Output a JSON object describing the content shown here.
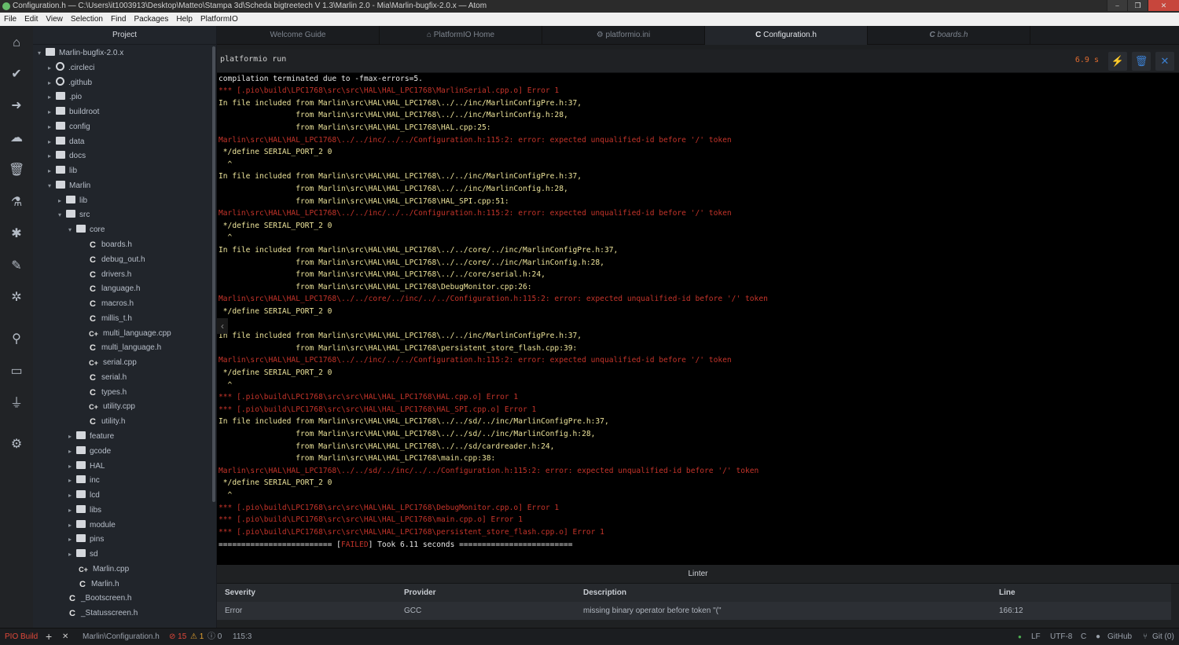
{
  "window": {
    "title": "Configuration.h — C:\\Users\\it1003913\\Desktop\\Matteo\\Stampa 3d\\Scheda bigtreetech V 1.3\\Marlin 2.0 - Mia\\Marlin-bugfix-2.0.x — Atom",
    "controls": [
      "⎯",
      "❐",
      "✕"
    ]
  },
  "menu": [
    "File",
    "Edit",
    "View",
    "Selection",
    "Find",
    "Packages",
    "Help",
    "PlatformIO"
  ],
  "leftbar_icons": [
    "home-icon",
    "check-icon",
    "arrow-right-icon",
    "cloud-upload-icon",
    "trash-icon",
    "flask-icon",
    "bug-icon",
    "edit-doc-icon",
    "device-icon",
    "search-icon",
    "terminal-icon",
    "plug-icon",
    "gear-icon"
  ],
  "tree": {
    "title": "Project",
    "rows": [
      {
        "label": "Marlin-bugfix-2.0.x",
        "indent": 0,
        "type": "folder",
        "open": true
      },
      {
        "label": ".circleci",
        "indent": 1,
        "type": "folder-special",
        "open": false
      },
      {
        "label": ".github",
        "indent": 1,
        "type": "folder-github",
        "open": false
      },
      {
        "label": ".pio",
        "indent": 1,
        "type": "folder",
        "open": false
      },
      {
        "label": "buildroot",
        "indent": 1,
        "type": "folder",
        "open": false
      },
      {
        "label": "config",
        "indent": 1,
        "type": "folder",
        "open": false
      },
      {
        "label": "data",
        "indent": 1,
        "type": "folder",
        "open": false
      },
      {
        "label": "docs",
        "indent": 1,
        "type": "folder",
        "open": false
      },
      {
        "label": "lib",
        "indent": 1,
        "type": "folder",
        "open": false
      },
      {
        "label": "Marlin",
        "indent": 1,
        "type": "folder",
        "open": true
      },
      {
        "label": "lib",
        "indent": 2,
        "type": "folder",
        "open": false
      },
      {
        "label": "src",
        "indent": 2,
        "type": "folder",
        "open": true
      },
      {
        "label": "core",
        "indent": 3,
        "type": "folder",
        "open": true
      },
      {
        "label": "boards.h",
        "indent": 4,
        "type": "file-c"
      },
      {
        "label": "debug_out.h",
        "indent": 4,
        "type": "file-c"
      },
      {
        "label": "drivers.h",
        "indent": 4,
        "type": "file-c"
      },
      {
        "label": "language.h",
        "indent": 4,
        "type": "file-c"
      },
      {
        "label": "macros.h",
        "indent": 4,
        "type": "file-c"
      },
      {
        "label": "millis_t.h",
        "indent": 4,
        "type": "file-c"
      },
      {
        "label": "multi_language.cpp",
        "indent": 4,
        "type": "file-cpp"
      },
      {
        "label": "multi_language.h",
        "indent": 4,
        "type": "file-c"
      },
      {
        "label": "serial.cpp",
        "indent": 4,
        "type": "file-cpp"
      },
      {
        "label": "serial.h",
        "indent": 4,
        "type": "file-c"
      },
      {
        "label": "types.h",
        "indent": 4,
        "type": "file-c"
      },
      {
        "label": "utility.cpp",
        "indent": 4,
        "type": "file-cpp"
      },
      {
        "label": "utility.h",
        "indent": 4,
        "type": "file-c"
      },
      {
        "label": "feature",
        "indent": 3,
        "type": "folder",
        "open": false
      },
      {
        "label": "gcode",
        "indent": 3,
        "type": "folder",
        "open": false
      },
      {
        "label": "HAL",
        "indent": 3,
        "type": "folder",
        "open": false
      },
      {
        "label": "inc",
        "indent": 3,
        "type": "folder",
        "open": false
      },
      {
        "label": "lcd",
        "indent": 3,
        "type": "folder",
        "open": false
      },
      {
        "label": "libs",
        "indent": 3,
        "type": "folder",
        "open": false
      },
      {
        "label": "module",
        "indent": 3,
        "type": "folder",
        "open": false
      },
      {
        "label": "pins",
        "indent": 3,
        "type": "folder",
        "open": false
      },
      {
        "label": "sd",
        "indent": 3,
        "type": "folder",
        "open": false
      },
      {
        "label": "Marlin.cpp",
        "indent": 3,
        "type": "file-cpp"
      },
      {
        "label": "Marlin.h",
        "indent": 3,
        "type": "file-c"
      },
      {
        "label": "_Bootscreen.h",
        "indent": 2,
        "type": "file-c"
      },
      {
        "label": "_Statusscreen.h",
        "indent": 2,
        "type": "file-c"
      }
    ]
  },
  "tabs": [
    {
      "label": "Welcome Guide",
      "icon": "",
      "active": false
    },
    {
      "label": "PlatformIO Home",
      "icon": "⌂",
      "active": false
    },
    {
      "label": "platformio.ini",
      "icon": "⚙",
      "active": false
    },
    {
      "label": "Configuration.h",
      "icon": "C",
      "active": true
    },
    {
      "label": "boards.h",
      "icon": "C",
      "active": false
    }
  ],
  "terminal": {
    "title": "platformio run",
    "elapsed": "6.9 s",
    "buttons": {
      "run": "⚡",
      "clear": "🗑",
      "close": "✕"
    },
    "lines": [
      {
        "t": "compilation terminated due to -fmax-errors=5.",
        "c": "w"
      },
      {
        "t": "*** [.pio\\build\\LPC1768\\src\\src\\HAL\\HAL_LPC1768\\MarlinSerial.cpp.o] Error 1",
        "c": "r"
      },
      {
        "t": "In file included from Marlin\\src\\HAL\\HAL_LPC1768\\../../inc/MarlinConfigPre.h:37,",
        "c": "y"
      },
      {
        "t": "                 from Marlin\\src\\HAL\\HAL_LPC1768\\../../inc/MarlinConfig.h:28,",
        "c": "y"
      },
      {
        "t": "                 from Marlin\\src\\HAL\\HAL_LPC1768\\HAL.cpp:25:",
        "c": "y"
      },
      {
        "t": "Marlin\\src\\HAL\\HAL_LPC1768\\../../inc/../../Configuration.h:115:2: error: expected unqualified-id before '/' token",
        "c": "r"
      },
      {
        "t": " */define SERIAL_PORT_2 0",
        "c": "y"
      },
      {
        "t": "  ^",
        "c": "y"
      },
      {
        "t": "In file included from Marlin\\src\\HAL\\HAL_LPC1768\\../../inc/MarlinConfigPre.h:37,",
        "c": "y"
      },
      {
        "t": "                 from Marlin\\src\\HAL\\HAL_LPC1768\\../../inc/MarlinConfig.h:28,",
        "c": "y"
      },
      {
        "t": "                 from Marlin\\src\\HAL\\HAL_LPC1768\\HAL_SPI.cpp:51:",
        "c": "y"
      },
      {
        "t": "Marlin\\src\\HAL\\HAL_LPC1768\\../../inc/../../Configuration.h:115:2: error: expected unqualified-id before '/' token",
        "c": "r"
      },
      {
        "t": " */define SERIAL_PORT_2 0",
        "c": "y"
      },
      {
        "t": "  ^",
        "c": "y"
      },
      {
        "t": "In file included from Marlin\\src\\HAL\\HAL_LPC1768\\../../core/../inc/MarlinConfigPre.h:37,",
        "c": "y"
      },
      {
        "t": "                 from Marlin\\src\\HAL\\HAL_LPC1768\\../../core/../inc/MarlinConfig.h:28,",
        "c": "y"
      },
      {
        "t": "                 from Marlin\\src\\HAL\\HAL_LPC1768\\../../core/serial.h:24,",
        "c": "y"
      },
      {
        "t": "                 from Marlin\\src\\HAL\\HAL_LPC1768\\DebugMonitor.cpp:26:",
        "c": "y"
      },
      {
        "t": "Marlin\\src\\HAL\\HAL_LPC1768\\../../core/../inc/../../Configuration.h:115:2: error: expected unqualified-id before '/' token",
        "c": "r"
      },
      {
        "t": " */define SERIAL_PORT_2 0",
        "c": "y"
      },
      {
        "t": "",
        "c": "y"
      },
      {
        "t": "In file included from Marlin\\src\\HAL\\HAL_LPC1768\\../../inc/MarlinConfigPre.h:37,",
        "c": "y"
      },
      {
        "t": "                 from Marlin\\src\\HAL\\HAL_LPC1768\\persistent_store_flash.cpp:39:",
        "c": "y"
      },
      {
        "t": "Marlin\\src\\HAL\\HAL_LPC1768\\../../inc/../../Configuration.h:115:2: error: expected unqualified-id before '/' token",
        "c": "r"
      },
      {
        "t": " */define SERIAL_PORT_2 0",
        "c": "y"
      },
      {
        "t": "  ^",
        "c": "y"
      },
      {
        "t": "*** [.pio\\build\\LPC1768\\src\\src\\HAL\\HAL_LPC1768\\HAL.cpp.o] Error 1",
        "c": "r"
      },
      {
        "t": "*** [.pio\\build\\LPC1768\\src\\src\\HAL\\HAL_LPC1768\\HAL_SPI.cpp.o] Error 1",
        "c": "r"
      },
      {
        "t": "In file included from Marlin\\src\\HAL\\HAL_LPC1768\\../../sd/../inc/MarlinConfigPre.h:37,",
        "c": "y"
      },
      {
        "t": "                 from Marlin\\src\\HAL\\HAL_LPC1768\\../../sd/../inc/MarlinConfig.h:28,",
        "c": "y"
      },
      {
        "t": "                 from Marlin\\src\\HAL\\HAL_LPC1768\\../../sd/cardreader.h:24,",
        "c": "y"
      },
      {
        "t": "                 from Marlin\\src\\HAL\\HAL_LPC1768\\main.cpp:38:",
        "c": "y"
      },
      {
        "t": "Marlin\\src\\HAL\\HAL_LPC1768\\../../sd/../inc/../../Configuration.h:115:2: error: expected unqualified-id before '/' token",
        "c": "r"
      },
      {
        "t": " */define SERIAL_PORT_2 0",
        "c": "y"
      },
      {
        "t": "  ^",
        "c": "y"
      },
      {
        "t": "*** [.pio\\build\\LPC1768\\src\\src\\HAL\\HAL_LPC1768\\DebugMonitor.cpp.o] Error 1",
        "c": "r"
      },
      {
        "t": "*** [.pio\\build\\LPC1768\\src\\src\\HAL\\HAL_LPC1768\\main.cpp.o] Error 1",
        "c": "r"
      },
      {
        "t": "*** [.pio\\build\\LPC1768\\src\\src\\HAL\\HAL_LPC1768\\persistent_store_flash.cpp.o] Error 1",
        "c": "r"
      }
    ],
    "summary": {
      "prefix": "========================= [",
      "status": "FAILED",
      "suffix": "] Took 6.11 seconds ========================="
    }
  },
  "linter": {
    "title": "Linter",
    "columns": [
      "Severity",
      "Provider",
      "Description",
      "Line"
    ],
    "row": [
      "Error",
      "GCC",
      "missing binary operator before token \"(\"",
      "166:12"
    ]
  },
  "status": {
    "pio_build": "PIO Build",
    "plus": "+",
    "close": "✕",
    "file_path": "Marlin\\Configuration.h",
    "errors": "⊘ 15",
    "warnings": "⚠ 1",
    "infos": "ⓘ 0",
    "cursor": "115:3",
    "line_ending": "LF",
    "encoding": "UTF-8",
    "grammar": "C",
    "github": "GitHub",
    "git": "Git (0)",
    "colors": {
      "error": "#e0483a",
      "warning": "#e0a030",
      "ok": "#4caf50"
    }
  },
  "colors": {
    "terminal_white": "#e8e8e8",
    "terminal_yellow": "#ece39a",
    "terminal_red": "#c4342a",
    "accent_blue": "#3c7fd0"
  }
}
